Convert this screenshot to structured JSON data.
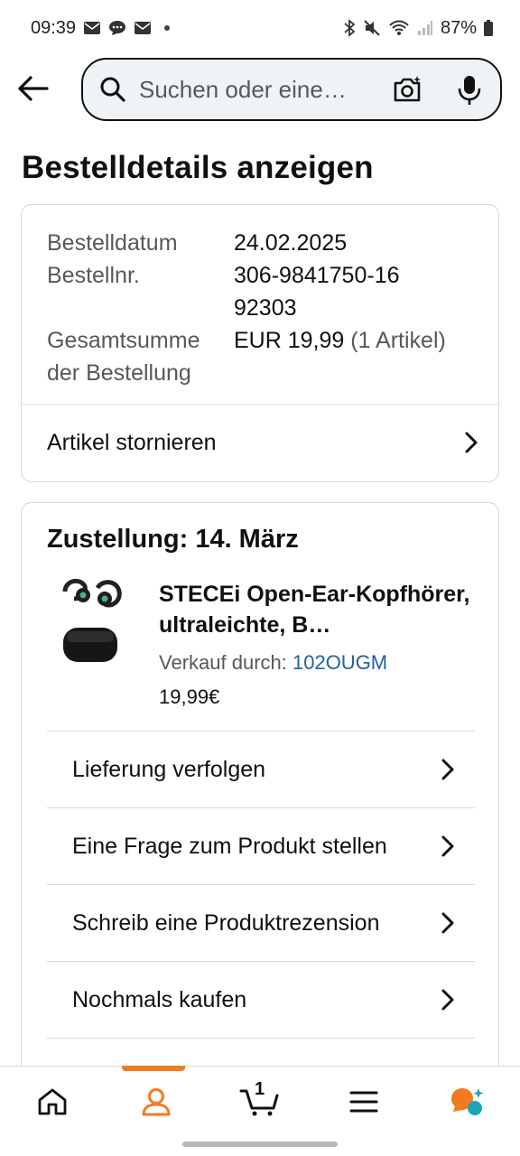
{
  "status_bar": {
    "time": "09:39",
    "battery": "87%",
    "icons": [
      "mail-icon",
      "chat-icon",
      "mail-icon",
      "bluetooth-icon",
      "mute-icon",
      "wifi-icon",
      "signal-icon",
      "battery-icon"
    ]
  },
  "search": {
    "placeholder": "Suchen oder eine…"
  },
  "page": {
    "title": "Bestelldetails anzeigen"
  },
  "order_summary": {
    "rows": [
      {
        "label": "Bestelldatum",
        "value": "24.02.2025"
      },
      {
        "label": "Bestellnr.",
        "value": "306-9841750-1692303"
      },
      {
        "label": "Gesamtsumme der Bestellung",
        "value": "EUR 19,99",
        "extra": " (1 Artikel)"
      }
    ],
    "cancel_label": "Artikel stornieren"
  },
  "delivery": {
    "heading": "Zustellung: 14. März",
    "product": {
      "title": "STECEi Open-Ear-Kopfhörer, ultraleichte, B…",
      "seller_label": "Verkauf durch: ",
      "seller_name": "102OUGM",
      "price": "19,99€"
    },
    "actions": [
      {
        "label": "Lieferung verfolgen"
      },
      {
        "label": "Eine Frage zum Produkt stellen"
      },
      {
        "label": "Schreib eine Produktrezension"
      },
      {
        "label": "Nochmals kaufen"
      }
    ]
  },
  "bottom_nav": {
    "items": [
      "home-icon",
      "account-icon",
      "cart-icon",
      "menu-icon",
      "rufus-icon"
    ],
    "cart_count": "1",
    "accent": "#f47a20"
  }
}
